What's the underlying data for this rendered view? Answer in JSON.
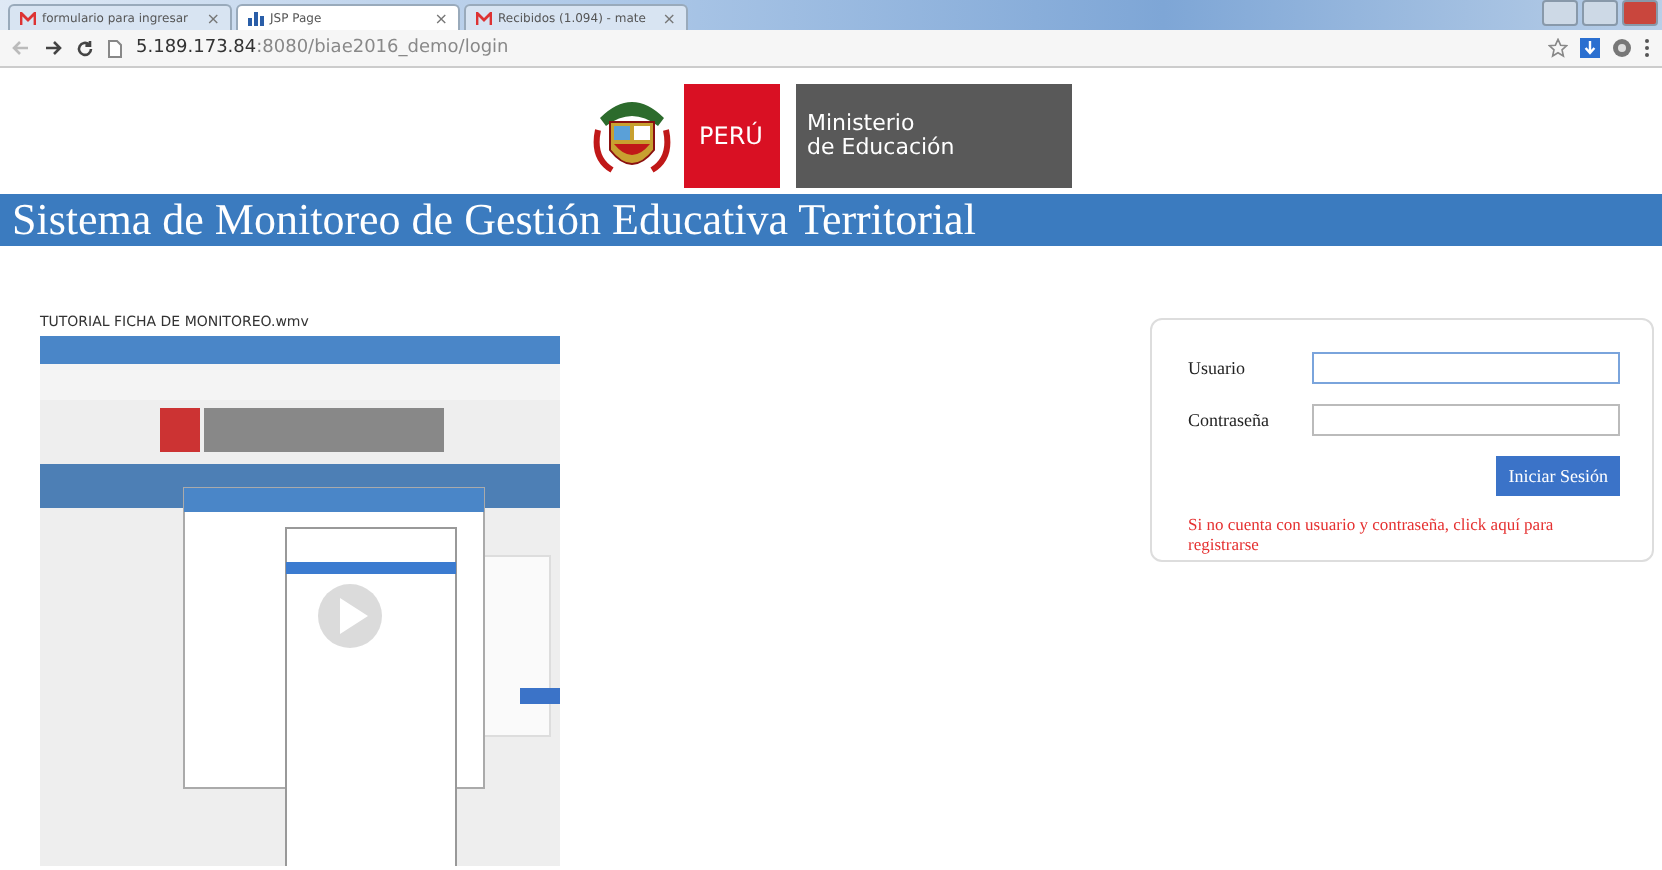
{
  "browser": {
    "tabs": [
      {
        "title": "formulario para ingresar",
        "selected": false,
        "kind": "mail"
      },
      {
        "title": "JSP Page",
        "selected": true,
        "kind": "chart"
      },
      {
        "title": "Recibidos (1.094) - mate",
        "selected": false,
        "kind": "mail"
      }
    ],
    "close_glyph": "×",
    "url_host": "5.189.173.84",
    "url_path": ":8080/biae2016_demo/login"
  },
  "header": {
    "country": "PERÚ",
    "ministry_line_1": "Ministerio",
    "ministry_line_2": "de Educación",
    "title": "Sistema de Monitoreo de Gestión Educativa Territorial"
  },
  "video": {
    "title": "TUTORIAL FICHA DE MONITOREO.wmv",
    "kind": "picture"
  },
  "login": {
    "user_label": "Usuario",
    "password_label": "Contraseña",
    "submit": "Iniciar Sesión",
    "register_link": "Si no cuenta con usuario y contraseña, click aquí para registrarse"
  }
}
